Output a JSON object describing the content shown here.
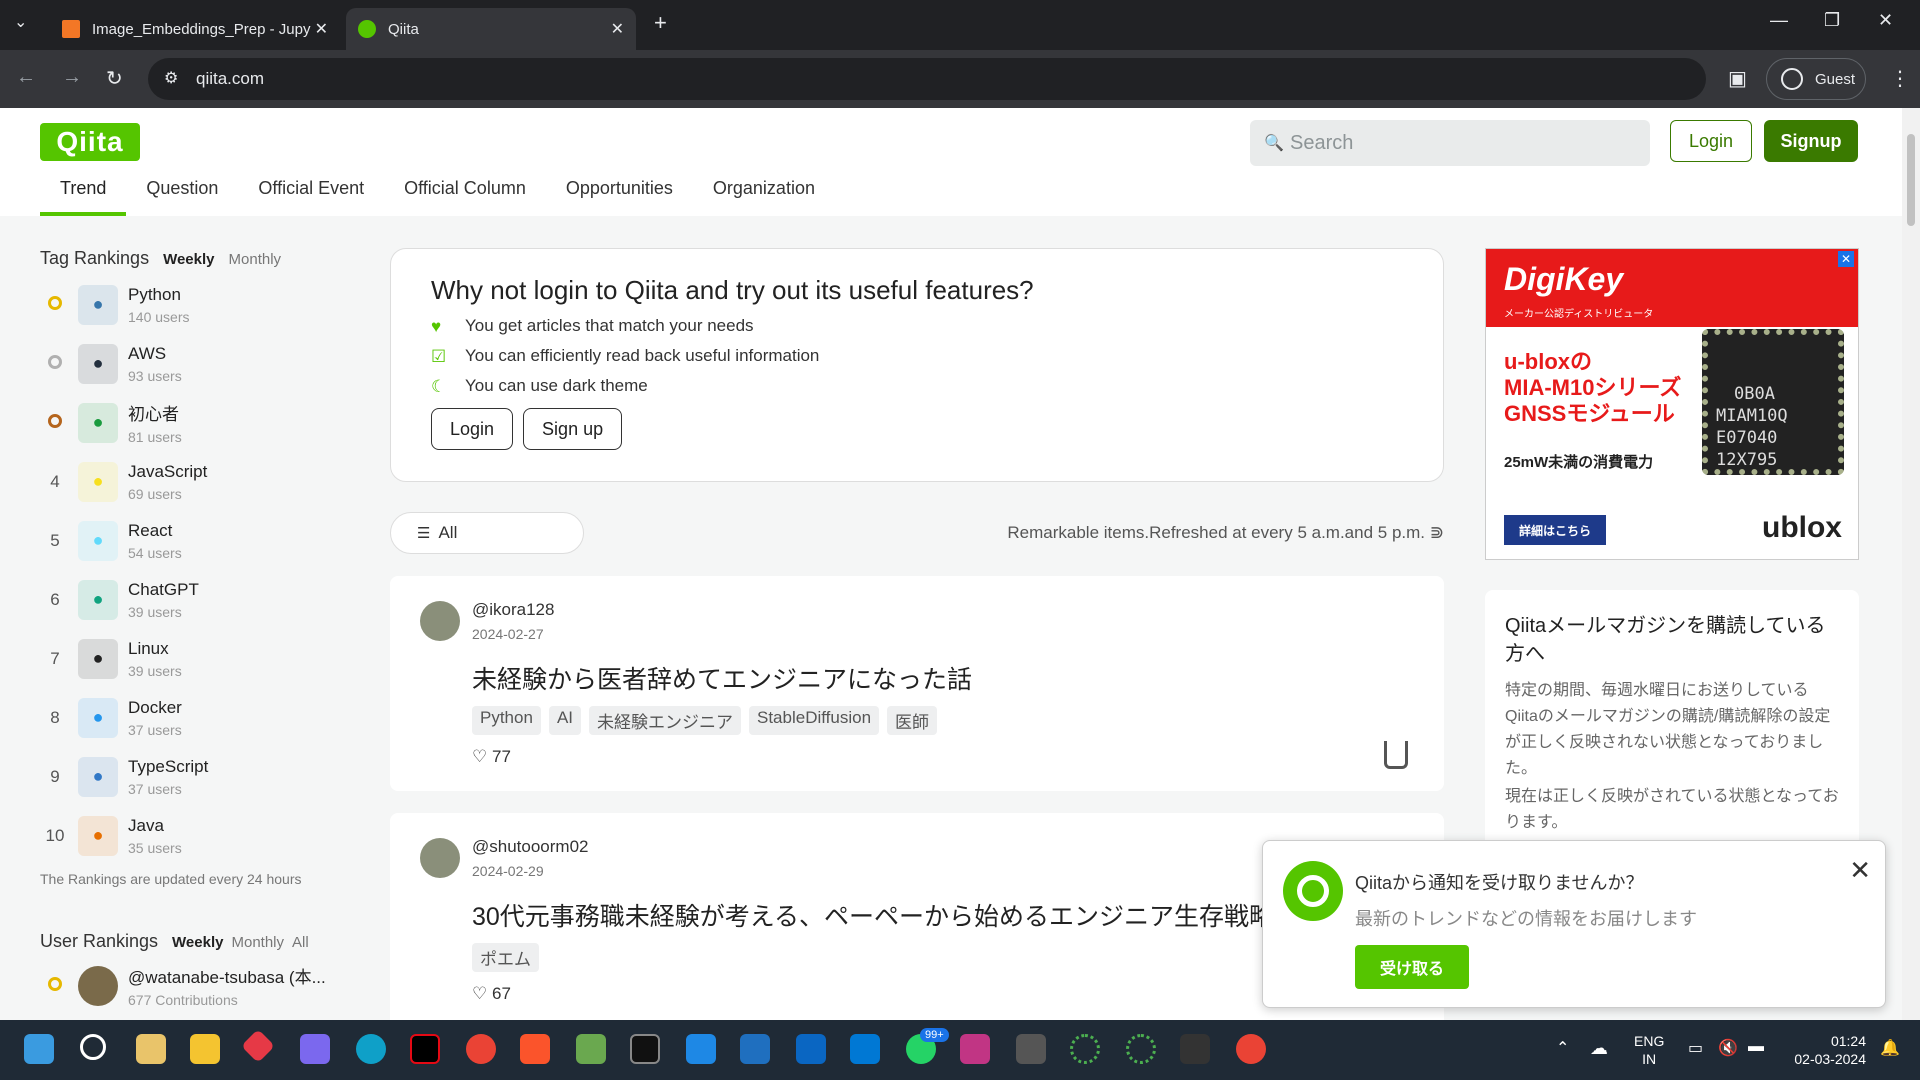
{
  "browser": {
    "tabs": [
      {
        "title": "Image_Embeddings_Prep - Jupy",
        "active": false
      },
      {
        "title": "Qiita",
        "active": true
      }
    ],
    "url": "qiita.com",
    "profile": "Guest"
  },
  "header": {
    "logo": "Qiita",
    "search_placeholder": "Search",
    "login": "Login",
    "signup": "Signup",
    "nav": [
      "Trend",
      "Question",
      "Official Event",
      "Official Column",
      "Opportunities",
      "Organization"
    ]
  },
  "tag_rankings": {
    "title": "Tag Rankings",
    "weekly": "Weekly",
    "monthly": "Monthly",
    "items": [
      {
        "rank": "",
        "name": "Python",
        "users": "140 users",
        "icon": "python-icon",
        "color": "#3776ab"
      },
      {
        "rank": "",
        "name": "AWS",
        "users": "93 users",
        "icon": "aws-icon",
        "color": "#232f3e"
      },
      {
        "rank": "",
        "name": "初心者",
        "users": "81 users",
        "icon": "beginner-icon",
        "color": "#1a9b3e"
      },
      {
        "rank": "4",
        "name": "JavaScript",
        "users": "69 users",
        "icon": "javascript-icon",
        "color": "#f7df1e"
      },
      {
        "rank": "5",
        "name": "React",
        "users": "54 users",
        "icon": "react-icon",
        "color": "#61dafb"
      },
      {
        "rank": "6",
        "name": "ChatGPT",
        "users": "39 users",
        "icon": "chatgpt-icon",
        "color": "#10a37f"
      },
      {
        "rank": "7",
        "name": "Linux",
        "users": "39 users",
        "icon": "linux-icon",
        "color": "#222222"
      },
      {
        "rank": "8",
        "name": "Docker",
        "users": "37 users",
        "icon": "docker-icon",
        "color": "#2496ed"
      },
      {
        "rank": "9",
        "name": "TypeScript",
        "users": "37 users",
        "icon": "typescript-icon",
        "color": "#3178c6"
      },
      {
        "rank": "10",
        "name": "Java",
        "users": "35 users",
        "icon": "java-icon",
        "color": "#e76f00"
      }
    ],
    "updated": "The Rankings are updated every 24 hours"
  },
  "user_rankings": {
    "title": "User Rankings",
    "weekly": "Weekly",
    "monthly": "Monthly",
    "all": "All",
    "top": {
      "name": "@watanabe-tsubasa (本...",
      "contrib": "677 Contributions"
    }
  },
  "promo": {
    "title": "Why not login to Qiita and try out its useful features?",
    "features": [
      "You get articles that match your needs",
      "You can efficiently read back useful information",
      "You can use dark theme"
    ],
    "login": "Login",
    "signup": "Sign up"
  },
  "filter": {
    "all": "All",
    "remark": "Remarkable items.Refreshed at every 5 a.m.and 5 p.m."
  },
  "articles": [
    {
      "user": "@ikora128",
      "date": "2024-02-27",
      "title": "未経験から医者辞めてエンジニアになった話",
      "tags": [
        "Python",
        "AI",
        "未経験エンジニア",
        "StableDiffusion",
        "医師"
      ],
      "likes": "77"
    },
    {
      "user": "@shutooorm02",
      "date": "2024-02-29",
      "title": "30代元事務職未経験が考える、ペーペーから始めるエンジニア生存戦略",
      "tags": [
        "ポエム"
      ],
      "likes": "67"
    }
  ],
  "ad": {
    "brand": "DigiKey",
    "sub": "メーカー公認ディストリビュータ",
    "lines": [
      "u-bloxの",
      "MIA-M10シリーズ",
      "GNSSモジュール"
    ],
    "power": "25mW未満の消費電力",
    "chip": [
      "0B0A",
      "MIAM10Q",
      "E07040",
      "12X795"
    ],
    "detail": "詳細はこちら",
    "maker": "ublox"
  },
  "magazine": {
    "title": "Qiitaメールマガジンを購読している方へ",
    "body1": "特定の期間、毎週水曜日にお送りしているQiitaのメールマガジンの購読/購読解除の設定が正しく反映されない状態となっておりました。",
    "body2": "現在は正しく反映がされている状態となっております。"
  },
  "notification": {
    "title": "Qiitaから通知を受け取りませんか？",
    "body": "最新のトレンドなどの情報をお届けします",
    "accept": "受け取る"
  },
  "taskbar": {
    "lang": "ENG",
    "region": "IN",
    "time": "01:24",
    "date": "02-03-2024",
    "badge": "99+"
  }
}
